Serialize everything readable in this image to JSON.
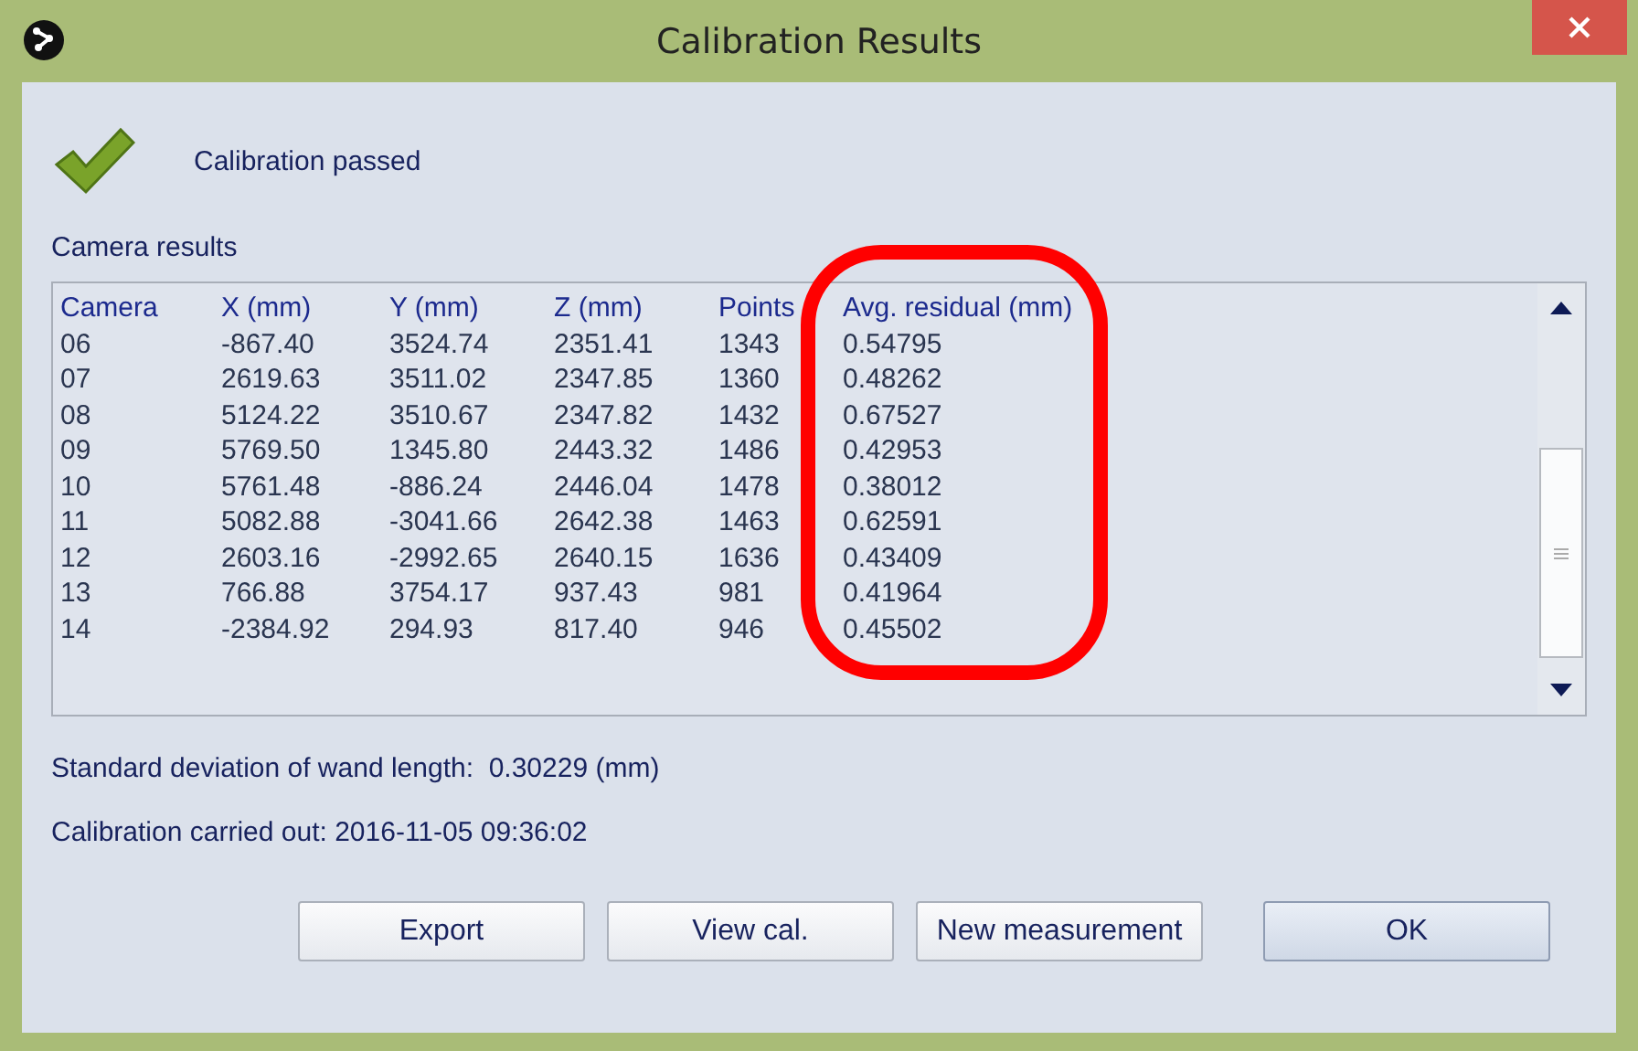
{
  "window": {
    "title": "Calibration Results"
  },
  "status": {
    "kind": "passed",
    "message": "Calibration passed"
  },
  "section_label": "Camera results",
  "table": {
    "columns": [
      "Camera",
      "X (mm)",
      "Y (mm)",
      "Z (mm)",
      "Points",
      "Avg. residual (mm)"
    ],
    "rows": [
      [
        "06",
        "-867.40",
        "3524.74",
        "2351.41",
        "1343",
        "0.54795"
      ],
      [
        "07",
        "2619.63",
        "3511.02",
        "2347.85",
        "1360",
        "0.48262"
      ],
      [
        "08",
        "5124.22",
        "3510.67",
        "2347.82",
        "1432",
        "0.67527"
      ],
      [
        "09",
        "5769.50",
        "1345.80",
        "2443.32",
        "1486",
        "0.42953"
      ],
      [
        "10",
        "5761.48",
        "-886.24",
        "2446.04",
        "1478",
        "0.38012"
      ],
      [
        "11",
        "5082.88",
        "-3041.66",
        "2642.38",
        "1463",
        "0.62591"
      ],
      [
        "12",
        "2603.16",
        "-2992.65",
        "2640.15",
        "1636",
        "0.43409"
      ],
      [
        "13",
        "766.88",
        "3754.17",
        "937.43",
        "981",
        "0.41964"
      ],
      [
        "14",
        "-2384.92",
        "294.93",
        "817.40",
        "946",
        "0.45502"
      ]
    ]
  },
  "std_deviation": "Standard deviation of wand length:  0.30229 (mm)",
  "carried_out": "Calibration carried out: 2016-11-05 09:36:02",
  "buttons": [
    {
      "label": "Export",
      "kind": "normal"
    },
    {
      "label": "View cal.",
      "kind": "normal"
    },
    {
      "label": "New measurement",
      "kind": "normal"
    },
    {
      "label": "OK",
      "kind": "default"
    }
  ]
}
